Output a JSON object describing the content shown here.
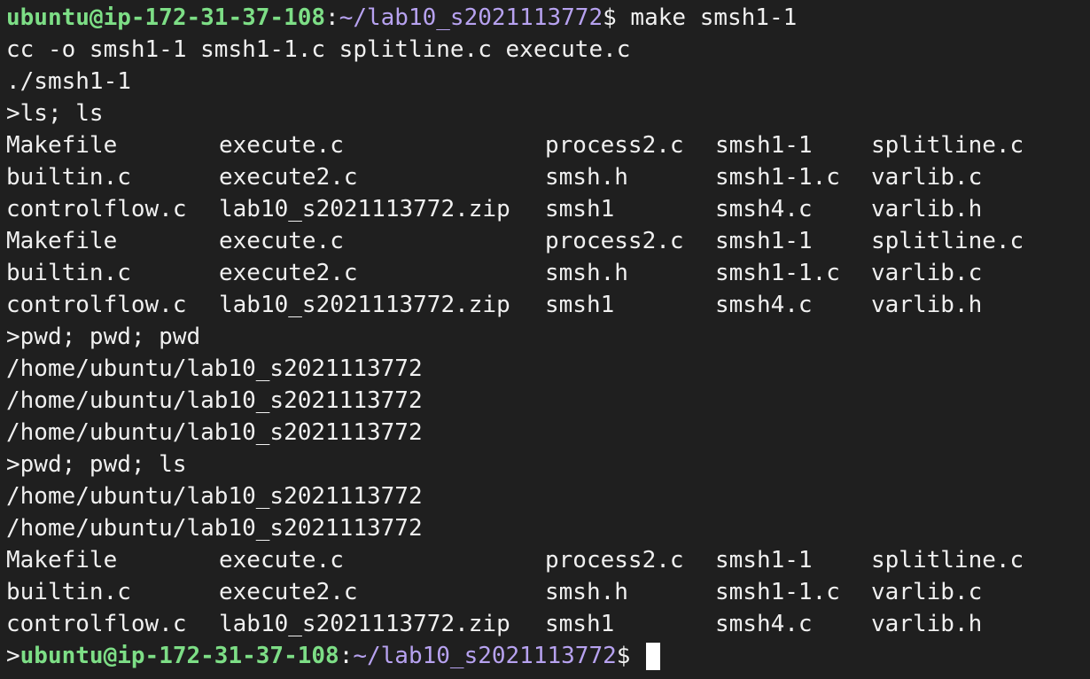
{
  "prompt": {
    "user_host": "ubuntu@ip-172-31-37-108",
    "colon": ":",
    "path": "~/lab10_s2021113772",
    "symbol": "$ "
  },
  "colors": {
    "background": "#1f1f1f",
    "foreground": "#f0f0f0",
    "user_host": "#7dde86",
    "path": "#b7a2f0",
    "cursor": "#ffffff"
  },
  "session": {
    "command": "make smsh1-1",
    "compile_line": "cc -o smsh1-1 smsh1-1.c splitline.c execute.c",
    "run_line": "./smsh1-1",
    "cmd1": ">ls; ls",
    "ls_output_1": [
      [
        "Makefile",
        "execute.c",
        "process2.c",
        "smsh1-1",
        "splitline.c"
      ],
      [
        "builtin.c",
        "execute2.c",
        "smsh.h",
        "smsh1-1.c",
        "varlib.c"
      ],
      [
        "controlflow.c",
        "lab10_s2021113772.zip",
        "smsh1",
        "smsh4.c",
        "varlib.h"
      ]
    ],
    "ls_output_2": [
      [
        "Makefile",
        "execute.c",
        "process2.c",
        "smsh1-1",
        "splitline.c"
      ],
      [
        "builtin.c",
        "execute2.c",
        "smsh.h",
        "smsh1-1.c",
        "varlib.c"
      ],
      [
        "controlflow.c",
        "lab10_s2021113772.zip",
        "smsh1",
        "smsh4.c",
        "varlib.h"
      ]
    ],
    "cmd2": ">pwd; pwd; pwd",
    "pwd_output_1": [
      "/home/ubuntu/lab10_s2021113772",
      "/home/ubuntu/lab10_s2021113772",
      "/home/ubuntu/lab10_s2021113772"
    ],
    "cmd3": ">pwd; pwd; ls",
    "pwd_output_2": [
      "/home/ubuntu/lab10_s2021113772",
      "/home/ubuntu/lab10_s2021113772"
    ],
    "ls_output_3": [
      [
        "Makefile",
        "execute.c",
        "process2.c",
        "smsh1-1",
        "splitline.c"
      ],
      [
        "builtin.c",
        "execute2.c",
        "smsh.h",
        "smsh1-1.c",
        "varlib.c"
      ],
      [
        "controlflow.c",
        "lab10_s2021113772.zip",
        "smsh1",
        "smsh4.c",
        "varlib.h"
      ]
    ],
    "final_prefix": ">"
  }
}
